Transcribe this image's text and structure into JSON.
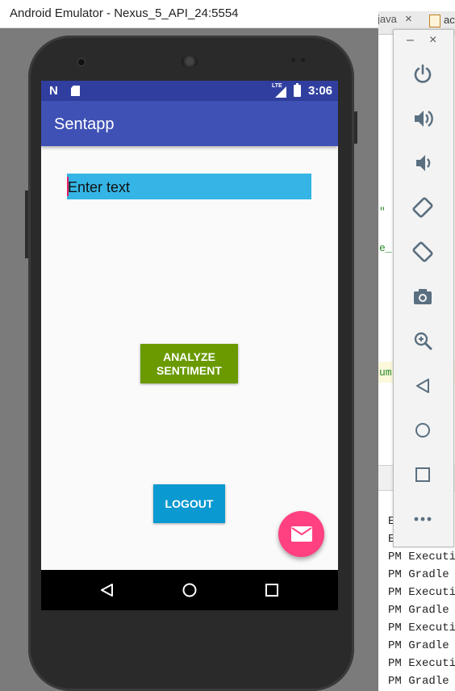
{
  "emulator": {
    "window_title": "Android Emulator - Nexus_5_API_24:5554"
  },
  "ide": {
    "tab1_label": "java",
    "tab1_close": "×",
    "tab2_label": "ac",
    "code_fragments": [
      "\"",
      "e_",
      "um"
    ],
    "console_lines": [
      "PM Executi",
      "PM Gradle",
      "PM Executi",
      "PM Gradle",
      "PM Executi",
      "PM Gradle",
      "PM Executi",
      "PM Gradle"
    ],
    "console_partial": [
      "E",
      "E"
    ]
  },
  "status_bar": {
    "notification_icon": "N",
    "lte_label": "LTE",
    "time": "3:06"
  },
  "app": {
    "title": "Sentapp",
    "input_placeholder": "Enter text",
    "analyze_button_line1": "ANALYZE",
    "analyze_button_line2": "SENTIMENT",
    "logout_button": "LOGOUT",
    "fab_icon": "email-icon"
  },
  "nav": {
    "back_icon": "back-icon",
    "home_icon": "home-icon",
    "recents_icon": "recents-icon"
  },
  "side_controls": {
    "minimize": "–",
    "close": "×",
    "icons": [
      "power-icon",
      "volume-up-icon",
      "volume-down-icon",
      "rotate-left-icon",
      "rotate-right-icon",
      "camera-icon",
      "zoom-icon",
      "back-icon",
      "home-icon",
      "overview-icon",
      "more-icon"
    ]
  },
  "colors": {
    "status_bar": "#303f9f",
    "app_bar": "#3f51b5",
    "input_bg": "#35b5e5",
    "analyze_btn": "#6a9a00",
    "logout_btn": "#0a99d0",
    "fab": "#ff4081"
  }
}
